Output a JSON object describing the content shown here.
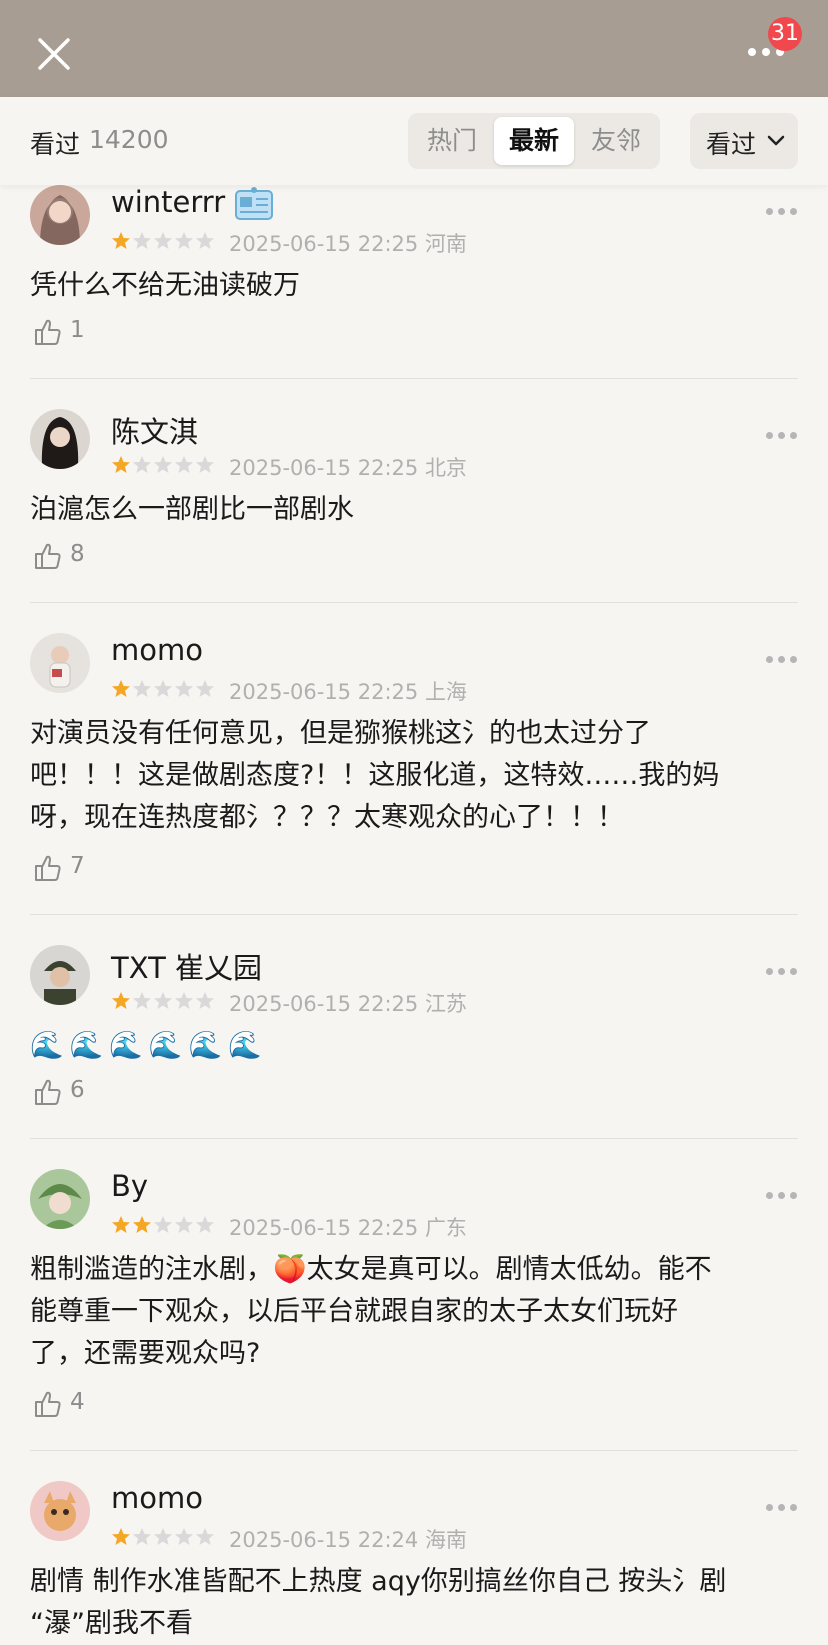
{
  "header": {
    "notification_count": "31"
  },
  "filter": {
    "seen_label": "看过",
    "seen_count": "14200",
    "tabs": [
      "热门",
      "最新",
      "友邻"
    ],
    "active_tab": "最新",
    "dropdown_label": "看过"
  },
  "reviews": [
    {
      "username": "winterrr",
      "rating": 1,
      "date": "2025-06-15 22:25",
      "location": "河南",
      "text": "凭什么不给无油读破万",
      "likes": "1"
    },
    {
      "username": "陈文淇",
      "rating": 1,
      "date": "2025-06-15 22:25",
      "location": "北京",
      "text": "泊滬怎么一部剧比一部剧水",
      "likes": "8"
    },
    {
      "username": "momo",
      "rating": 1,
      "date": "2025-06-15 22:25",
      "location": "上海",
      "text": "对演员没有任何意见，但是猕猴桃这氵的也太过分了\n吧！！！这是做剧态度?！！这服化道，这特效……我的妈\n呀，现在连热度都氵？？？太寒观众的心了！！！",
      "likes": "7"
    },
    {
      "username": "TXT 崔乂园",
      "rating": 1,
      "date": "2025-06-15 22:25",
      "location": "江苏",
      "text": "🌊🌊🌊🌊🌊🌊",
      "likes": "6"
    },
    {
      "username": "By",
      "rating": 2,
      "date": "2025-06-15 22:25",
      "location": "广东",
      "text": "粗制滥造的注水剧，🍑太女是真可以。剧情太低幼。能不\n能尊重一下观众，以后平台就跟自家的太子太女们玩好\n了，还需要观众吗?",
      "likes": "4"
    },
    {
      "username": "momo",
      "rating": 1,
      "date": "2025-06-15 22:24",
      "location": "海南",
      "text": "剧情 制作水准皆配不上热度 aqy你别搞丝你自己 按头氵剧\n“瀑”剧我不看",
      "likes": ""
    }
  ],
  "colors": {
    "header_bg": "#a79d93",
    "badge": "#f0484c",
    "star_filled": "#f5a623",
    "star_empty": "#d9d9d9"
  }
}
